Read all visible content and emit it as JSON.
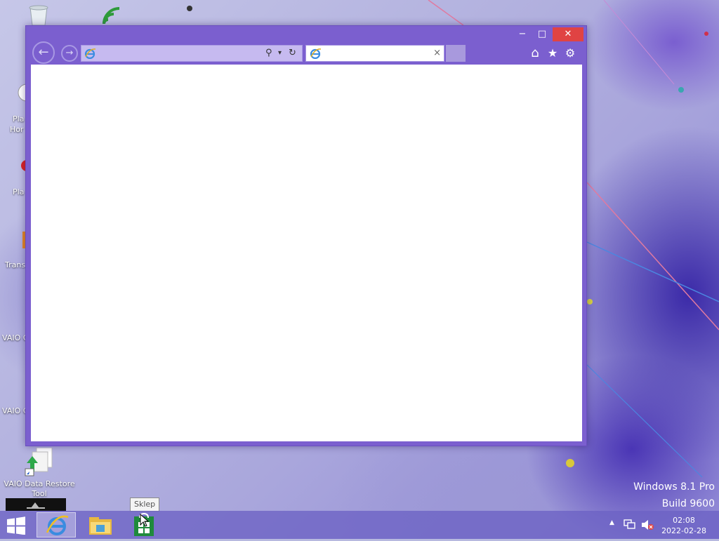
{
  "desktop": {
    "icons": [
      {
        "id": "recycle-bin",
        "label": ""
      },
      {
        "id": "wireless",
        "label": ""
      },
      {
        "id": "play-home",
        "label": "Play\nHon"
      },
      {
        "id": "play",
        "label": "Play"
      },
      {
        "id": "trans",
        "label": "Trans"
      },
      {
        "id": "vaio-1",
        "label": "VAIO C"
      },
      {
        "id": "vaio-2",
        "label": "VAIO C"
      },
      {
        "id": "vaio-data-restore",
        "label": "VAIO Data Restore\nTool"
      }
    ]
  },
  "browser": {
    "caption": {
      "minimize": "−",
      "maximize": "□",
      "close": "✕"
    },
    "nav": {
      "back": "←",
      "forward": "→"
    },
    "address": {
      "value": "",
      "search_glyph": "⚲",
      "dropdown_glyph": "▾",
      "refresh_glyph": "↻"
    },
    "tab": {
      "title": "",
      "close": "×"
    },
    "tools": {
      "home": "⌂",
      "favorites": "★",
      "settings": "⚙"
    }
  },
  "watermark": {
    "line1": "Windows 8.1 Pro",
    "line2": "Build 9600"
  },
  "taskbar": {
    "tooltip": "Sklep",
    "tray": {
      "show_hidden": "▲"
    },
    "clock": {
      "time": "02:08",
      "date": "2022-02-28"
    }
  },
  "colors": {
    "window_frame": "#7b5fcf",
    "close_button": "#e04343",
    "taskbar": "#6c62c4"
  }
}
